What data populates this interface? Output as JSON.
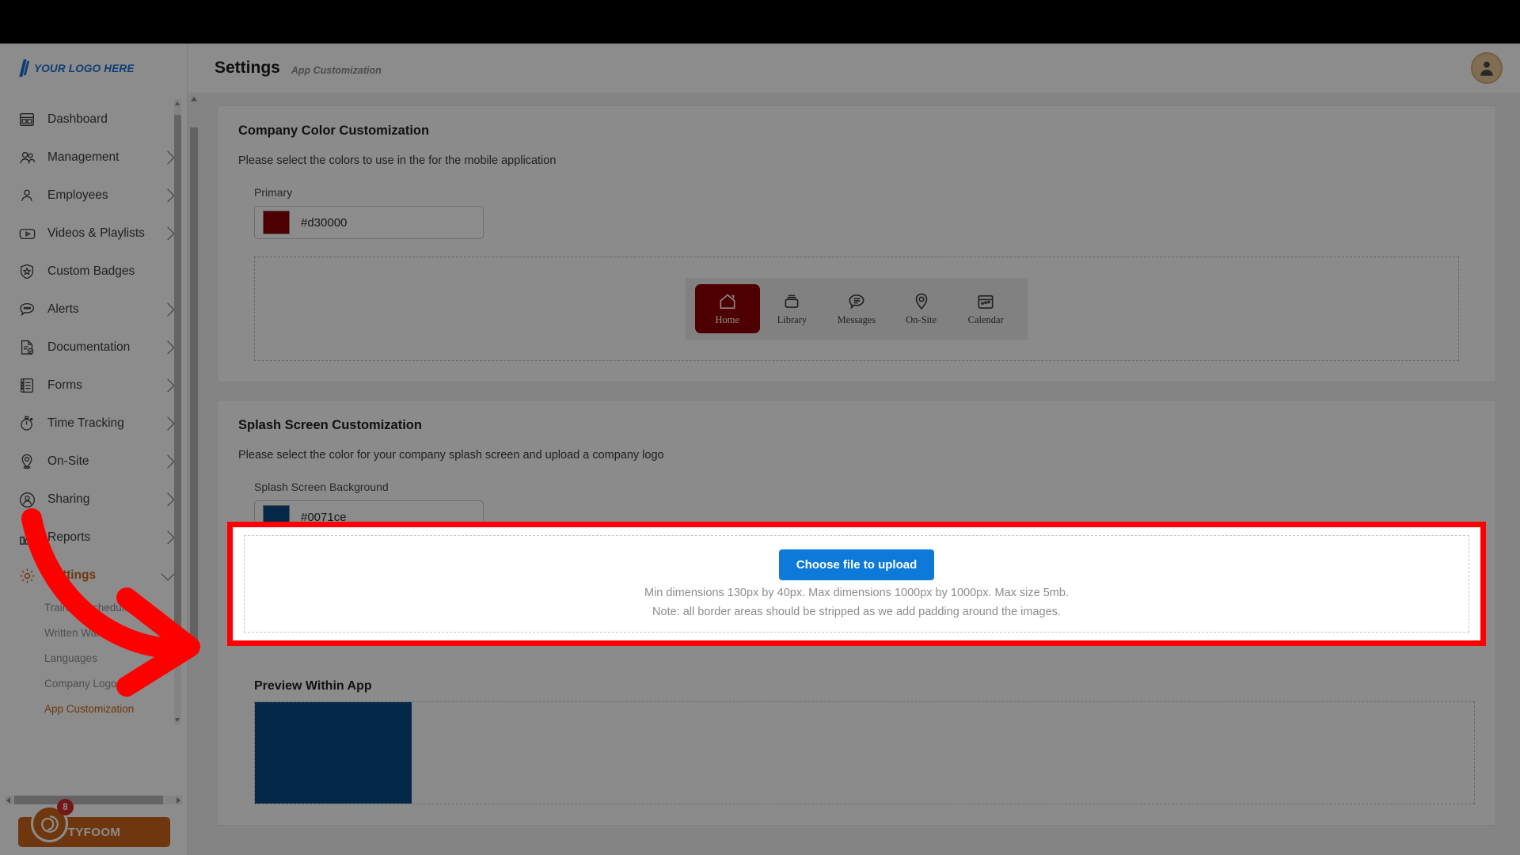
{
  "header": {
    "title": "Settings",
    "subtitle": "App Customization",
    "avatar_icon": "user-avatar-icon"
  },
  "sidebar": {
    "logo_text": "YOUR LOGO HERE",
    "items": [
      {
        "label": "Dashboard",
        "icon": "dashboard-icon",
        "has_chevron": false
      },
      {
        "label": "Management",
        "icon": "management-icon",
        "has_chevron": true
      },
      {
        "label": "Employees",
        "icon": "employees-icon",
        "has_chevron": true
      },
      {
        "label": "Videos & Playlists",
        "icon": "video-icon",
        "has_chevron": true
      },
      {
        "label": "Custom Badges",
        "icon": "badge-shield-icon",
        "has_chevron": false
      },
      {
        "label": "Alerts",
        "icon": "alerts-chat-icon",
        "has_chevron": true
      },
      {
        "label": "Documentation",
        "icon": "document-check-icon",
        "has_chevron": true
      },
      {
        "label": "Forms",
        "icon": "forms-list-icon",
        "has_chevron": true
      },
      {
        "label": "Time Tracking",
        "icon": "stopwatch-icon",
        "has_chevron": true
      },
      {
        "label": "On-Site",
        "icon": "map-pin-icon",
        "has_chevron": true
      },
      {
        "label": "Sharing",
        "icon": "sharing-user-icon",
        "has_chevron": true
      },
      {
        "label": "Reports",
        "icon": "bar-chart-icon",
        "has_chevron": true
      },
      {
        "label": "Settings",
        "icon": "gear-icon",
        "has_chevron": true,
        "active": true
      }
    ],
    "sub_items": [
      {
        "label": "Training Schedule",
        "active": false
      },
      {
        "label": "Written Warnings",
        "active": false
      },
      {
        "label": "Languages",
        "active": false
      },
      {
        "label": "Company Logo",
        "active": false
      },
      {
        "label": "App Customization",
        "active": true
      }
    ],
    "brand_name": "TYFOOM",
    "brand_badge_count": "8",
    "brand_color": "#c8651b"
  },
  "company_color_card": {
    "title": "Company Color Customization",
    "description": "Please select the colors to use in the for the mobile application",
    "primary_label": "Primary",
    "primary_value": "#d30000",
    "mobile_preview": {
      "items": [
        {
          "label": "Home",
          "icon": "home-icon",
          "selected": true
        },
        {
          "label": "Library",
          "icon": "library-icon",
          "selected": false
        },
        {
          "label": "Messages",
          "icon": "messages-icon",
          "selected": false
        },
        {
          "label": "On-Site",
          "icon": "pin-icon",
          "selected": false
        },
        {
          "label": "Calendar",
          "icon": "calendar-icon",
          "selected": false
        }
      ]
    }
  },
  "splash_card": {
    "title": "Splash Screen Customization",
    "description": "Please select the color for your company splash screen and upload a company logo",
    "background_label": "Splash Screen Background",
    "background_value": "#0071ce"
  },
  "upload_area": {
    "button_label": "Choose file to upload",
    "hint_line_1": "Min dimensions 130px by 40px. Max dimensions 1000px by 1000px. Max size 5mb.",
    "hint_line_2": "Note: all border areas should be stripped as we add padding around the images.",
    "button_color": "#0d7ada",
    "highlight_color": "#ff0000"
  },
  "preview_within_app": {
    "title": "Preview Within App",
    "splash_color": "#0071ce"
  },
  "annotation": {
    "arrow_color": "#ff0000",
    "arrow_name": "red-pointer-arrow"
  }
}
